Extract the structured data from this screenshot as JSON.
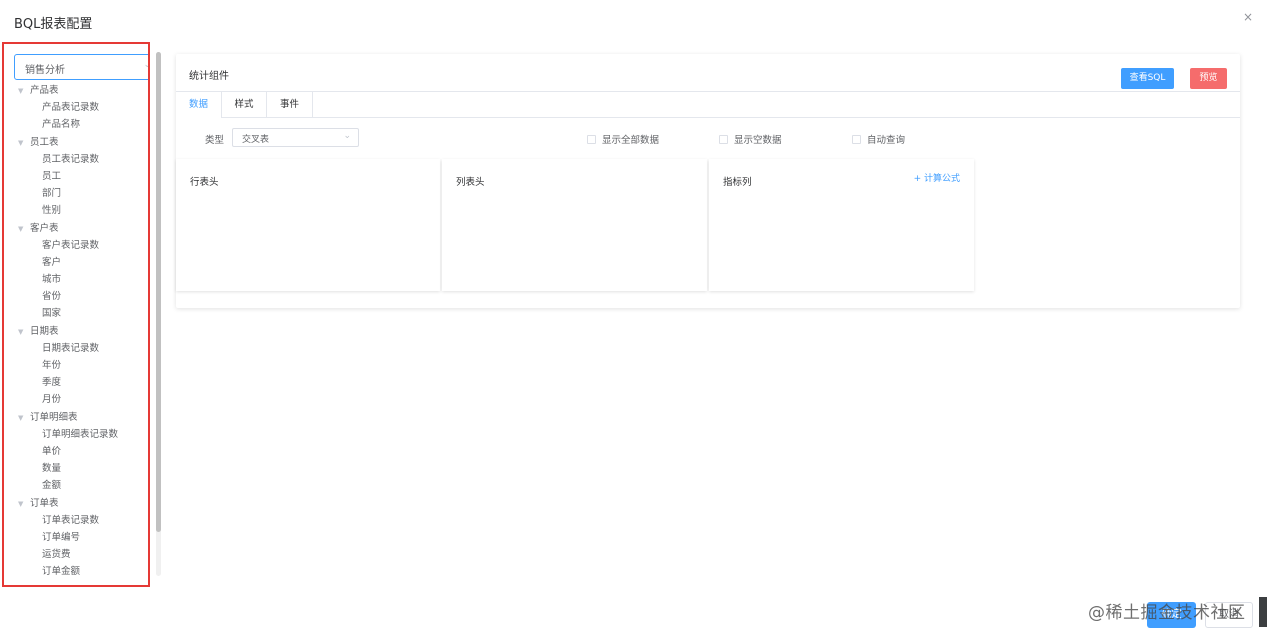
{
  "dialog": {
    "title": "BQL报表配置",
    "close_glyph": "×"
  },
  "sidebar": {
    "datasource": "销售分析",
    "tree": [
      {
        "label": "产品表",
        "children": [
          "产品表记录数",
          "产品名称"
        ]
      },
      {
        "label": "员工表",
        "children": [
          "员工表记录数",
          "员工",
          "部门",
          "性别"
        ]
      },
      {
        "label": "客户表",
        "children": [
          "客户表记录数",
          "客户",
          "城市",
          "省份",
          "国家"
        ]
      },
      {
        "label": "日期表",
        "children": [
          "日期表记录数",
          "年份",
          "季度",
          "月份"
        ]
      },
      {
        "label": "订单明细表",
        "children": [
          "订单明细表记录数",
          "单价",
          "数量",
          "金额"
        ]
      },
      {
        "label": "订单表",
        "children": [
          "订单表记录数",
          "订单编号",
          "运货费",
          "订单金额"
        ]
      }
    ]
  },
  "card": {
    "title": "统计组件",
    "view_sql_label": "查看SQL",
    "preview_label": "预览",
    "tabs": [
      "数据",
      "样式",
      "事件"
    ],
    "type_label": "类型",
    "type_value": "交叉表",
    "checkboxes": [
      "显示全部数据",
      "显示空数据",
      "自动查询"
    ],
    "zones": {
      "row": "行表头",
      "col": "列表头",
      "metric": "指标列",
      "formula": "+ 计算公式"
    }
  },
  "footer": {
    "ok_label": "确定",
    "cancel_label": "取消"
  },
  "watermark": "@稀土掘金技术社区",
  "colors": {
    "primary": "#409eff",
    "danger": "#f56c6c",
    "highlight_border": "#e53935"
  }
}
